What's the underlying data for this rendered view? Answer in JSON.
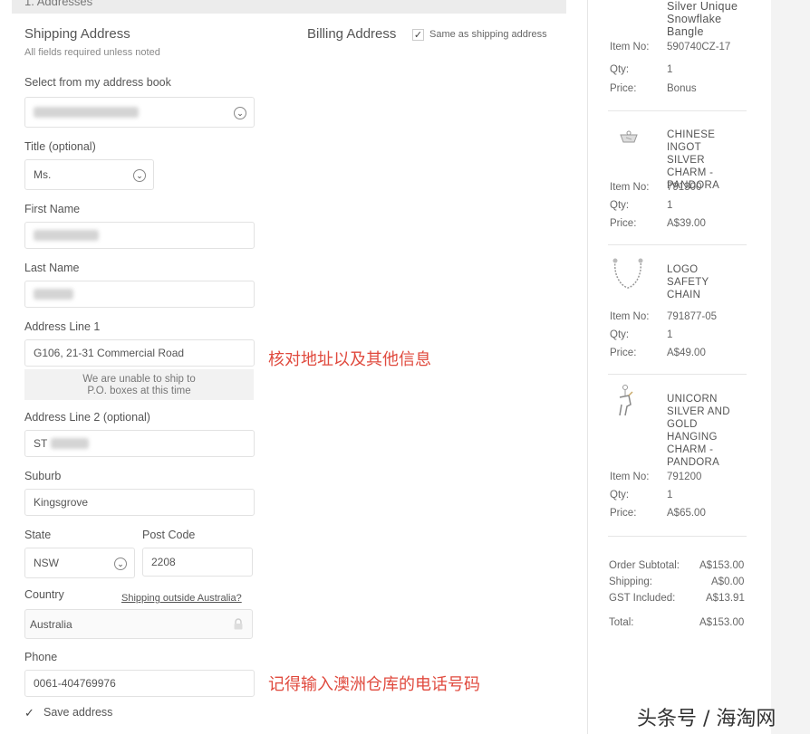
{
  "section": {
    "title": "1. Addresses"
  },
  "shipping": {
    "heading": "Shipping Address",
    "subtext": "All fields required unless noted",
    "address_book_label": "Select from my address book",
    "title_label": "Title (optional)",
    "title_value": "Ms.",
    "first_name_label": "First Name",
    "last_name_label": "Last Name",
    "address1_label": "Address Line 1",
    "address1_value": "G106, 21-31 Commercial Road",
    "po_note_line1": "We are unable to ship to",
    "po_note_line2": "P.O. boxes at this time",
    "address2_label": "Address Line 2 (optional)",
    "address2_value": "ST",
    "suburb_label": "Suburb",
    "suburb_value": "Kingsgrove",
    "state_label": "State",
    "state_value": "NSW",
    "postcode_label": "Post Code",
    "postcode_value": "2208",
    "country_label": "Country",
    "country_value": "Australia",
    "shipping_outside_link": "Shipping outside Australia?",
    "phone_label": "Phone",
    "phone_value": "0061-404769976",
    "save_address_label": "Save address"
  },
  "billing": {
    "heading": "Billing Address",
    "same_as_shipping_label": "Same as shipping address",
    "same_as_shipping_checked": true
  },
  "annotations": {
    "check_address": "核对地址以及其他信息",
    "remember_phone": "记得输入澳洲仓库的电话号码"
  },
  "cart": {
    "item_no_label": "Item No:",
    "qty_label": "Qty:",
    "price_label": "Price:",
    "items": [
      {
        "name_lines": [
          "Silver Unique",
          "Snowflake",
          "Bangle"
        ],
        "item_no": "590740CZ-17",
        "qty": "1",
        "price": "Bonus"
      },
      {
        "name_lines": [
          "CHINESE",
          "INGOT SILVER",
          "CHARM -",
          "PANDORA"
        ],
        "item_no": "791300",
        "qty": "1",
        "price": "A$39.00"
      },
      {
        "name_lines": [
          "LOGO SAFETY",
          "CHAIN"
        ],
        "item_no": "791877-05",
        "qty": "1",
        "price": "A$49.00"
      },
      {
        "name_lines": [
          "UNICORN",
          "SILVER AND",
          "GOLD",
          "HANGING",
          "CHARM -",
          "PANDORA"
        ],
        "item_no": "791200",
        "qty": "1",
        "price": "A$65.00"
      }
    ],
    "totals": [
      {
        "label": "Order Subtotal:",
        "value": "A$153.00"
      },
      {
        "label": "Shipping:",
        "value": "A$0.00"
      },
      {
        "label": "GST Included:",
        "value": "A$13.91"
      },
      {
        "label": "Total:",
        "value": "A$153.00"
      }
    ]
  },
  "watermark": "头条号 / 海淘网",
  "icons": {
    "chevron": "chevron-down-icon",
    "check": "check-icon",
    "lock": "lock-icon"
  }
}
